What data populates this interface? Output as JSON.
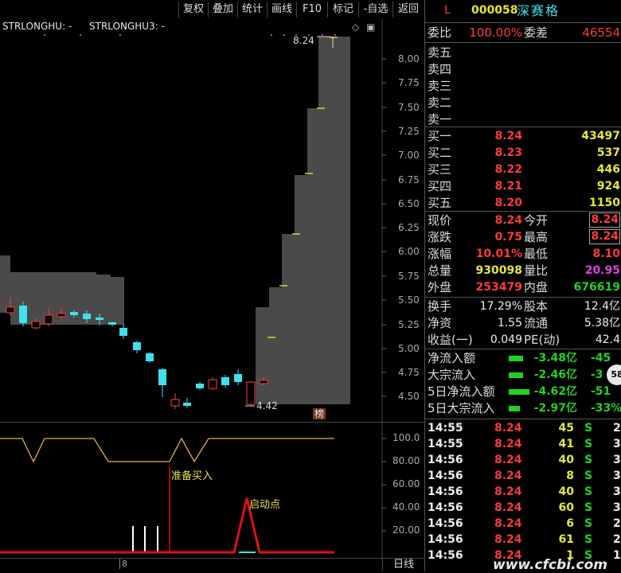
{
  "toolbar": {
    "buttons": [
      "复权",
      "叠加",
      "统计",
      "画线",
      "F10",
      "标记",
      "-自选",
      "返回"
    ]
  },
  "chart": {
    "indicator1": "STRLONGHU: -",
    "indicator2": "STRLONGHU3: -",
    "high_label": "8.24",
    "low_label": "4.42",
    "price_axis": [
      "8.00",
      "7.75",
      "7.50",
      "7.25",
      "7.00",
      "6.75",
      "6.50",
      "6.25",
      "6.00",
      "5.75",
      "5.50",
      "5.25",
      "5.00",
      "4.75",
      "4.50"
    ],
    "bang_label": "榜",
    "ind_axis": [
      "100.0",
      "80.00",
      "60.00",
      "40.00",
      "20.00"
    ],
    "ind_label_buy": "准备买入",
    "ind_label_start": "启动点",
    "x_tick": "8",
    "period_label": "日线"
  },
  "stock": {
    "market": "L",
    "code": "000058",
    "name": "深赛格"
  },
  "panel": {
    "weibi_label": "委比",
    "weibi": "100.00%",
    "weicha_label": "委差",
    "weicha": "46554",
    "sells": [
      {
        "label": "卖五"
      },
      {
        "label": "卖四"
      },
      {
        "label": "卖三"
      },
      {
        "label": "卖二"
      },
      {
        "label": "卖一"
      }
    ],
    "buys": [
      {
        "label": "买一",
        "price": "8.24",
        "vol": "43497"
      },
      {
        "label": "买二",
        "price": "8.23",
        "vol": "537"
      },
      {
        "label": "买三",
        "price": "8.22",
        "vol": "446"
      },
      {
        "label": "买四",
        "price": "8.21",
        "vol": "924"
      },
      {
        "label": "买五",
        "price": "8.20",
        "vol": "1150"
      }
    ],
    "quote": [
      {
        "l1": "现价",
        "v1": "8.24",
        "l2": "今开",
        "v2": "8.24"
      },
      {
        "l1": "涨跌",
        "v1": "0.75",
        "l2": "最高",
        "v2": "8.24"
      },
      {
        "l1": "涨幅",
        "v1": "10.01%",
        "l2": "最低",
        "v2": "8.10"
      },
      {
        "l1": "总量",
        "v1": "930098",
        "l2": "量比",
        "v2": "20.95"
      },
      {
        "l1": "外盘",
        "v1": "253479",
        "l2": "内盘",
        "v2": "676619"
      }
    ],
    "fin": [
      {
        "l1": "换手",
        "v1": "17.29%",
        "l2": "股本",
        "v2": "12.4亿"
      },
      {
        "l1": "净资",
        "v1": "1.55",
        "l2": "流通",
        "v2": "5.38亿"
      },
      {
        "l1": "收益(一)",
        "v1": "0.049",
        "l2": "PE(动)",
        "v2": "42.4"
      }
    ],
    "flows": [
      {
        "label": "净流入额",
        "value": "-3.48亿",
        "pct": "-45"
      },
      {
        "label": "大宗流入",
        "value": "-2.46亿",
        "pct": "-3"
      },
      {
        "label": "5日净流入额",
        "value": "-4.62亿",
        "pct": "-51"
      },
      {
        "label": "5日大宗流入",
        "value": "-2.97亿",
        "pct": "-33%"
      }
    ],
    "flow_badge": "58",
    "ticks": [
      {
        "time": "14:55",
        "price": "8.24",
        "vol": "45",
        "side": "S",
        "n": "2"
      },
      {
        "time": "14:55",
        "price": "8.24",
        "vol": "41",
        "side": "S",
        "n": "3"
      },
      {
        "time": "14:56",
        "price": "8.24",
        "vol": "40",
        "side": "S",
        "n": "3"
      },
      {
        "time": "14:56",
        "price": "8.24",
        "vol": "8",
        "side": "S",
        "n": "3"
      },
      {
        "time": "14:56",
        "price": "8.24",
        "vol": "40",
        "side": "S",
        "n": "3"
      },
      {
        "time": "14:56",
        "price": "8.24",
        "vol": "60",
        "side": "S",
        "n": "3"
      },
      {
        "time": "14:56",
        "price": "8.24",
        "vol": "6",
        "side": "S",
        "n": "2"
      },
      {
        "time": "14:56",
        "price": "8.24",
        "vol": "61",
        "side": "S",
        "n": "2"
      },
      {
        "time": "14:56",
        "price": "8.24",
        "vol": "1",
        "side": "S",
        "n": "1"
      }
    ],
    "watermark": "www.cfcbi.com"
  },
  "colors": {
    "up": "#ff3b3b",
    "down": "#40e0f0",
    "band": "#4a4a4a",
    "ind_line": "#e8b040",
    "ind_red": "#e01010"
  }
}
